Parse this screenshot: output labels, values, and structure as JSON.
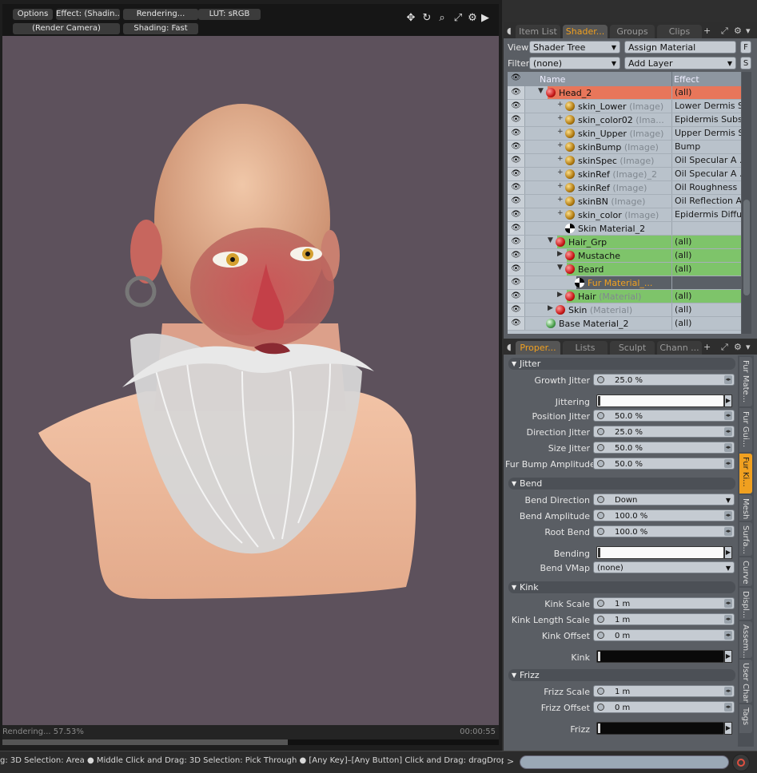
{
  "viewport": {
    "toolbar": {
      "options": "Options",
      "effect": "Effect: (Shadin...",
      "rendering": "Rendering...",
      "lut": "LUT: sRGB",
      "camera": "(Render Camera)",
      "shading": "Shading: Fast"
    },
    "icons": [
      "move-icon",
      "rotate-icon",
      "zoom-icon",
      "fit-icon",
      "gear-icon",
      "play-icon"
    ],
    "render_status": "Rendering... 57.53%",
    "render_progress": 0.5753,
    "render_time": "00:00:55"
  },
  "statusbar": {
    "text": "g: 3D Selection: Area ● Middle Click and Drag: 3D Selection: Pick Through ● [Any Key]–[Any Button] Click and Drag: dragDrop...",
    "prompt": ">"
  },
  "top_tabs": {
    "tabs": [
      "Item List",
      "Shader...",
      "Groups",
      "Clips"
    ],
    "active": 1,
    "plus": "+"
  },
  "shader_controls": {
    "view_label": "View",
    "view_value": "Shader Tree",
    "assign_material": "Assign Material",
    "f_button": "F",
    "filter_label": "Filter",
    "filter_value": "(none)",
    "add_layer": "Add Layer",
    "s_button": "S"
  },
  "tree": {
    "col_name": "Name",
    "col_effect": "Effect",
    "rows": [
      {
        "name": "Head_2",
        "type": "",
        "effect": "(all)",
        "ball": "red",
        "indent": 1,
        "twist": "▼",
        "bg": "#e8765a",
        "color": "#111"
      },
      {
        "name": "skin_Lower",
        "type": "(Image)",
        "effect": "Lower Dermis S...",
        "ball": "gold",
        "indent": 3,
        "twist": "+",
        "bg": "",
        "color": "#111"
      },
      {
        "name": "skin_color02",
        "type": "(Ima...",
        "effect": "Epidermis Subs...",
        "ball": "gold",
        "indent": 3,
        "twist": "+",
        "bg": "",
        "color": "#111"
      },
      {
        "name": "skin_Upper",
        "type": "(Image)",
        "effect": "Upper Dermis S...",
        "ball": "gold",
        "indent": 3,
        "twist": "+",
        "bg": "",
        "color": "#111"
      },
      {
        "name": "skinBump",
        "type": "(Image)",
        "effect": "Bump",
        "ball": "gold",
        "indent": 3,
        "twist": "+",
        "bg": "",
        "color": "#111"
      },
      {
        "name": "skinSpec",
        "type": "(Image)",
        "effect": "Oil Specular A ...",
        "ball": "gold",
        "indent": 3,
        "twist": "+",
        "bg": "",
        "color": "#111"
      },
      {
        "name": "skinRef",
        "type": "(Image)_2",
        "effect": "Oil Specular A ...",
        "ball": "gold",
        "indent": 3,
        "twist": "+",
        "bg": "",
        "color": "#111"
      },
      {
        "name": "skinRef",
        "type": "(Image)",
        "effect": "Oil Roughness",
        "ball": "gold",
        "indent": 3,
        "twist": "+",
        "bg": "",
        "color": "#111"
      },
      {
        "name": "skinBN",
        "type": "(Image)",
        "effect": "Oil Reflection A...",
        "ball": "gold",
        "indent": 3,
        "twist": "+",
        "bg": "",
        "color": "#111"
      },
      {
        "name": "skin_color",
        "type": "(Image)",
        "effect": "Epidermis Diffu...",
        "ball": "gold",
        "indent": 3,
        "twist": "+",
        "bg": "",
        "color": "#111"
      },
      {
        "name": "Skin Material_2",
        "type": "",
        "effect": "",
        "ball": "checker",
        "indent": 3,
        "twist": "",
        "bg": "",
        "color": "#111"
      },
      {
        "name": "Hair_Grp",
        "type": "",
        "effect": "(all)",
        "ball": "red",
        "indent": 2,
        "twist": "▼",
        "bg": "#7ec46a",
        "color": "#111"
      },
      {
        "name": "Mustache",
        "type": "",
        "effect": "(all)",
        "ball": "red",
        "indent": 3,
        "twist": "▶",
        "bg": "#7ec46a",
        "color": "#111"
      },
      {
        "name": "Beard",
        "type": "",
        "effect": "(all)",
        "ball": "red",
        "indent": 3,
        "twist": "▼",
        "bg": "#7ec46a",
        "color": "#111"
      },
      {
        "name": "Fur Material_...",
        "type": "",
        "effect": "",
        "ball": "checker",
        "indent": 4,
        "twist": "",
        "bg": "#5a6066",
        "color": "#f0a020"
      },
      {
        "name": "Hair",
        "type": "(Material)",
        "effect": "(all)",
        "ball": "red",
        "indent": 3,
        "twist": "▶",
        "bg": "#7ec46a",
        "color": "#111"
      },
      {
        "name": "Skin",
        "type": "(Material)",
        "effect": "(all)",
        "ball": "red",
        "indent": 2,
        "twist": "▶",
        "bg": "",
        "color": "#111"
      },
      {
        "name": "Base Material_2",
        "type": "",
        "effect": "(all)",
        "ball": "green",
        "indent": 1,
        "twist": "",
        "bg": "",
        "color": "#111"
      }
    ]
  },
  "bottom_tabs": {
    "tabs": [
      "Proper...",
      "Lists",
      "Sculpt",
      "Chann ..."
    ],
    "active": 0,
    "plus": "+"
  },
  "properties": {
    "sections": [
      {
        "title": "Jitter",
        "items": [
          {
            "label": "Growth Jitter",
            "kind": "value",
            "value": "25.0 %"
          },
          {
            "label": "Jittering",
            "kind": "gradient",
            "gradient": "white"
          },
          {
            "label": "Position Jitter",
            "kind": "value",
            "value": "50.0 %"
          },
          {
            "label": "Direction Jitter",
            "kind": "value",
            "value": "25.0 %"
          },
          {
            "label": "Size Jitter",
            "kind": "value",
            "value": "50.0 %"
          },
          {
            "label": "Fur Bump Amplitude",
            "kind": "value",
            "value": "50.0 %"
          }
        ]
      },
      {
        "title": "Bend",
        "items": [
          {
            "label": "Bend Direction",
            "kind": "dropdown",
            "value": "Down"
          },
          {
            "label": "Bend Amplitude",
            "kind": "value",
            "value": "100.0 %"
          },
          {
            "label": "Root Bend",
            "kind": "value",
            "value": "100.0 %"
          },
          {
            "label": "Bending",
            "kind": "gradient",
            "gradient": "white"
          },
          {
            "label": "Bend VMap",
            "kind": "dropdown-wide",
            "value": "(none)"
          }
        ]
      },
      {
        "title": "Kink",
        "items": [
          {
            "label": "Kink Scale",
            "kind": "value",
            "value": "1 m"
          },
          {
            "label": "Kink Length Scale",
            "kind": "value",
            "value": "1 m"
          },
          {
            "label": "Kink Offset",
            "kind": "value",
            "value": "0 m"
          },
          {
            "label": "Kink",
            "kind": "gradient",
            "gradient": "black"
          }
        ]
      },
      {
        "title": "Frizz",
        "items": [
          {
            "label": "Frizz Scale",
            "kind": "value",
            "value": "1 m"
          },
          {
            "label": "Frizz Offset",
            "kind": "value",
            "value": "0 m"
          },
          {
            "label": "Frizz",
            "kind": "gradient",
            "gradient": "black"
          }
        ]
      }
    ]
  },
  "vertical_tabs": {
    "tabs": [
      "Fur Mate...",
      "Fur Gui...",
      "Fur Ki...",
      "Mesh",
      "Surfa...",
      "Curve",
      "Displ...",
      "Assem...",
      "User Chan ...",
      "Tags"
    ],
    "active": 2
  },
  "colors": {
    "render_bg": "#5d515c",
    "accent": "#f0a020",
    "head_row": "#e8765a",
    "hair_rows": "#7ec46a"
  }
}
